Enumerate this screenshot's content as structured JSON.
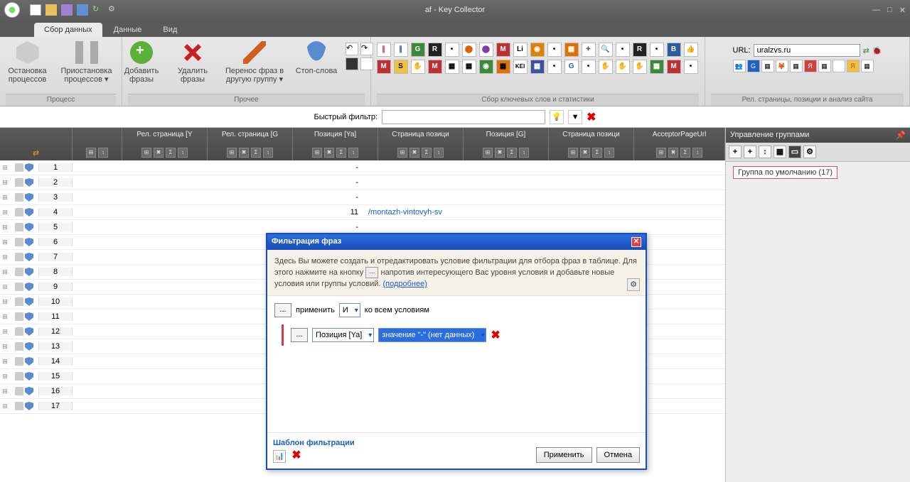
{
  "window": {
    "title": "af - Key Collector"
  },
  "tabs": {
    "t1": "Сбор данных",
    "t2": "Данные",
    "t3": "Вид"
  },
  "ribbon": {
    "process": {
      "stop": "Остановка процессов",
      "pause": "Приостановка процессов ▾",
      "cap": "Процесс"
    },
    "other": {
      "addp": "Добавить фразы",
      "delp": "Удалить фразы",
      "move": "Перенос фраз в другую группу ▾",
      "stopw": "Стоп-слова",
      "cap": "Прочее"
    },
    "collect": {
      "cap": "Сбор ключевых слов и статистики"
    },
    "url": {
      "label": "URL:",
      "value": "uralzvs.ru",
      "cap": "Рел. страницы, позиции и анализ сайта"
    }
  },
  "filter": {
    "label": "Быстрый фильтр:"
  },
  "columns": {
    "c0": "",
    "rp_y": "Рел. страница [Y",
    "rp_g": "Рел. страница [G",
    "pos_y": "Позиция [Ya]",
    "sp1": "Страница позици",
    "pos_g": "Позиция [G]",
    "sp2": "Страница позици",
    "acc": "AcceptorPageUrl"
  },
  "rows": [
    {
      "n": 1
    },
    {
      "n": 2
    },
    {
      "n": 3
    },
    {
      "n": 4,
      "pos": "11",
      "url": "/montazh-vintovyh-sv"
    },
    {
      "n": 5
    },
    {
      "n": 6
    },
    {
      "n": 7
    },
    {
      "n": 8
    },
    {
      "n": 9
    },
    {
      "n": 10
    },
    {
      "n": 11
    },
    {
      "n": 12
    },
    {
      "n": 13
    },
    {
      "n": 14
    },
    {
      "n": 15
    },
    {
      "n": 16
    },
    {
      "n": 17
    }
  ],
  "dash": "-",
  "side": {
    "title": "Управление группами",
    "node": "Группа по умолчанию (17)"
  },
  "dialog": {
    "title": "Фильтрация фраз",
    "info1": "Здесь Вы можете создать и отредактировать условие фильтрации для отбора фраз в таблице. Для этого нажмите на кнопку",
    "info2": "напротив интересующего Вас уровня условия и добавьте новые условия или группы условий.",
    "more": "(подробнее)",
    "apply_word": "применить",
    "and": "И",
    "toall": "ко всем условиям",
    "field": "Позиция [Ya]",
    "val": "значение \"-\" (нет данных)",
    "tmpl": "Шаблон фильтрации",
    "btn_apply": "Применить",
    "btn_cancel": "Отмена"
  }
}
